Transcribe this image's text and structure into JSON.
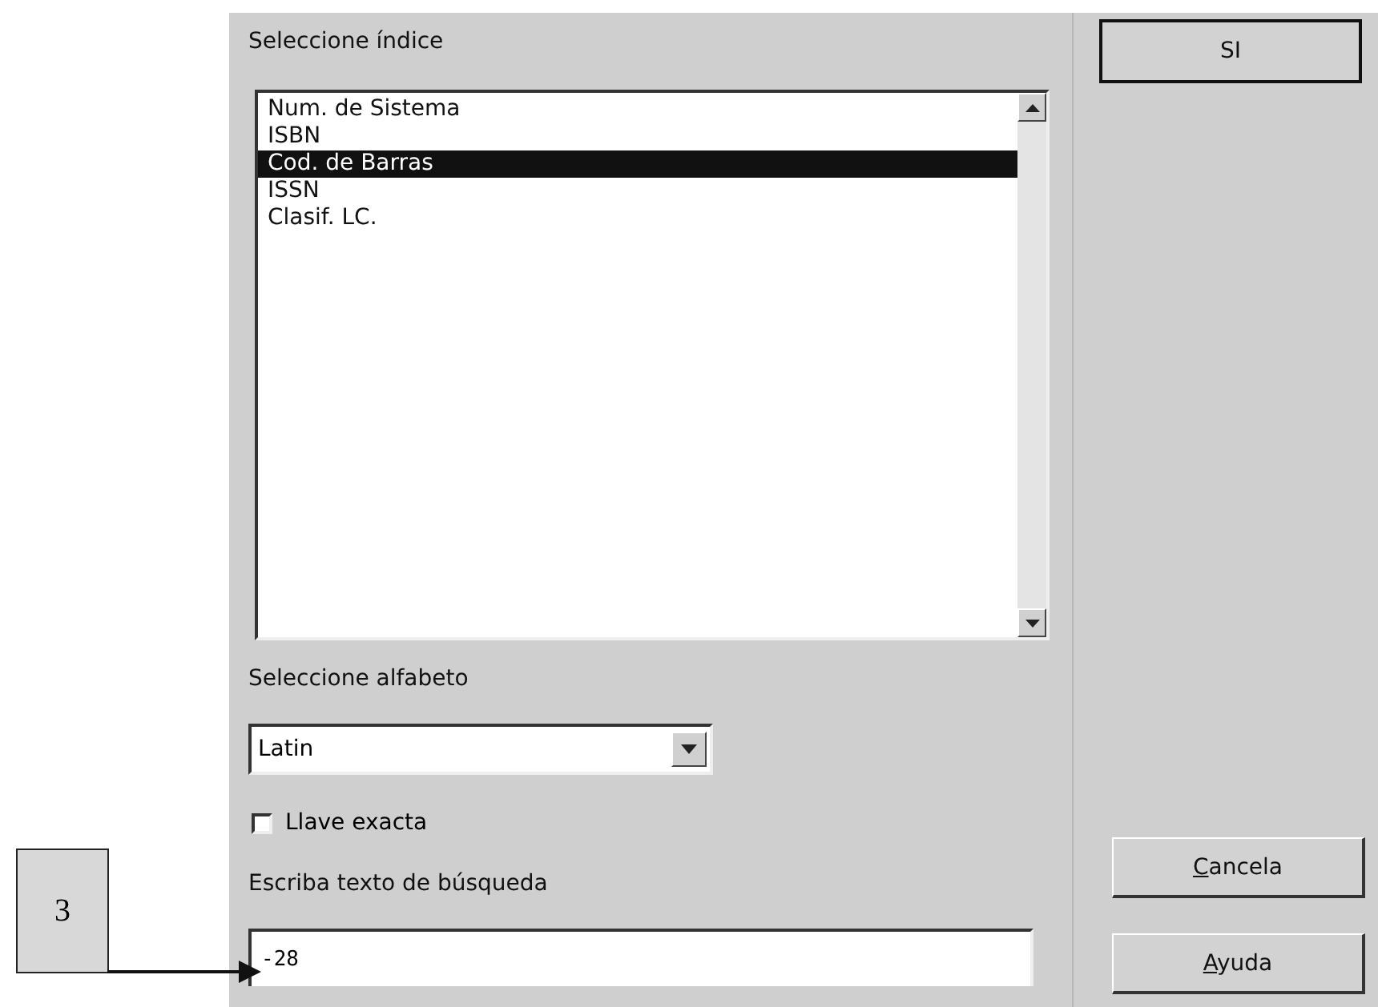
{
  "annotation": {
    "label": "3"
  },
  "index_section": {
    "label": "Seleccione índice",
    "items": [
      {
        "label": "Num. de Sistema",
        "selected": false
      },
      {
        "label": "ISBN",
        "selected": false
      },
      {
        "label": "Cod. de Barras",
        "selected": true
      },
      {
        "label": "ISSN",
        "selected": false
      },
      {
        "label": "Clasif. LC.",
        "selected": false
      }
    ]
  },
  "alphabet_section": {
    "label": "Seleccione alfabeto",
    "value": "Latin"
  },
  "exact_key": {
    "label": "Llave exacta",
    "checked": false
  },
  "search": {
    "label": "Escriba texto de búsqueda",
    "value": "-28"
  },
  "buttons": [
    {
      "label": "SI",
      "kind": "default"
    },
    {
      "label": "Cancela",
      "kind": "normal"
    },
    {
      "label": "Ayuda",
      "kind": "normal"
    }
  ]
}
